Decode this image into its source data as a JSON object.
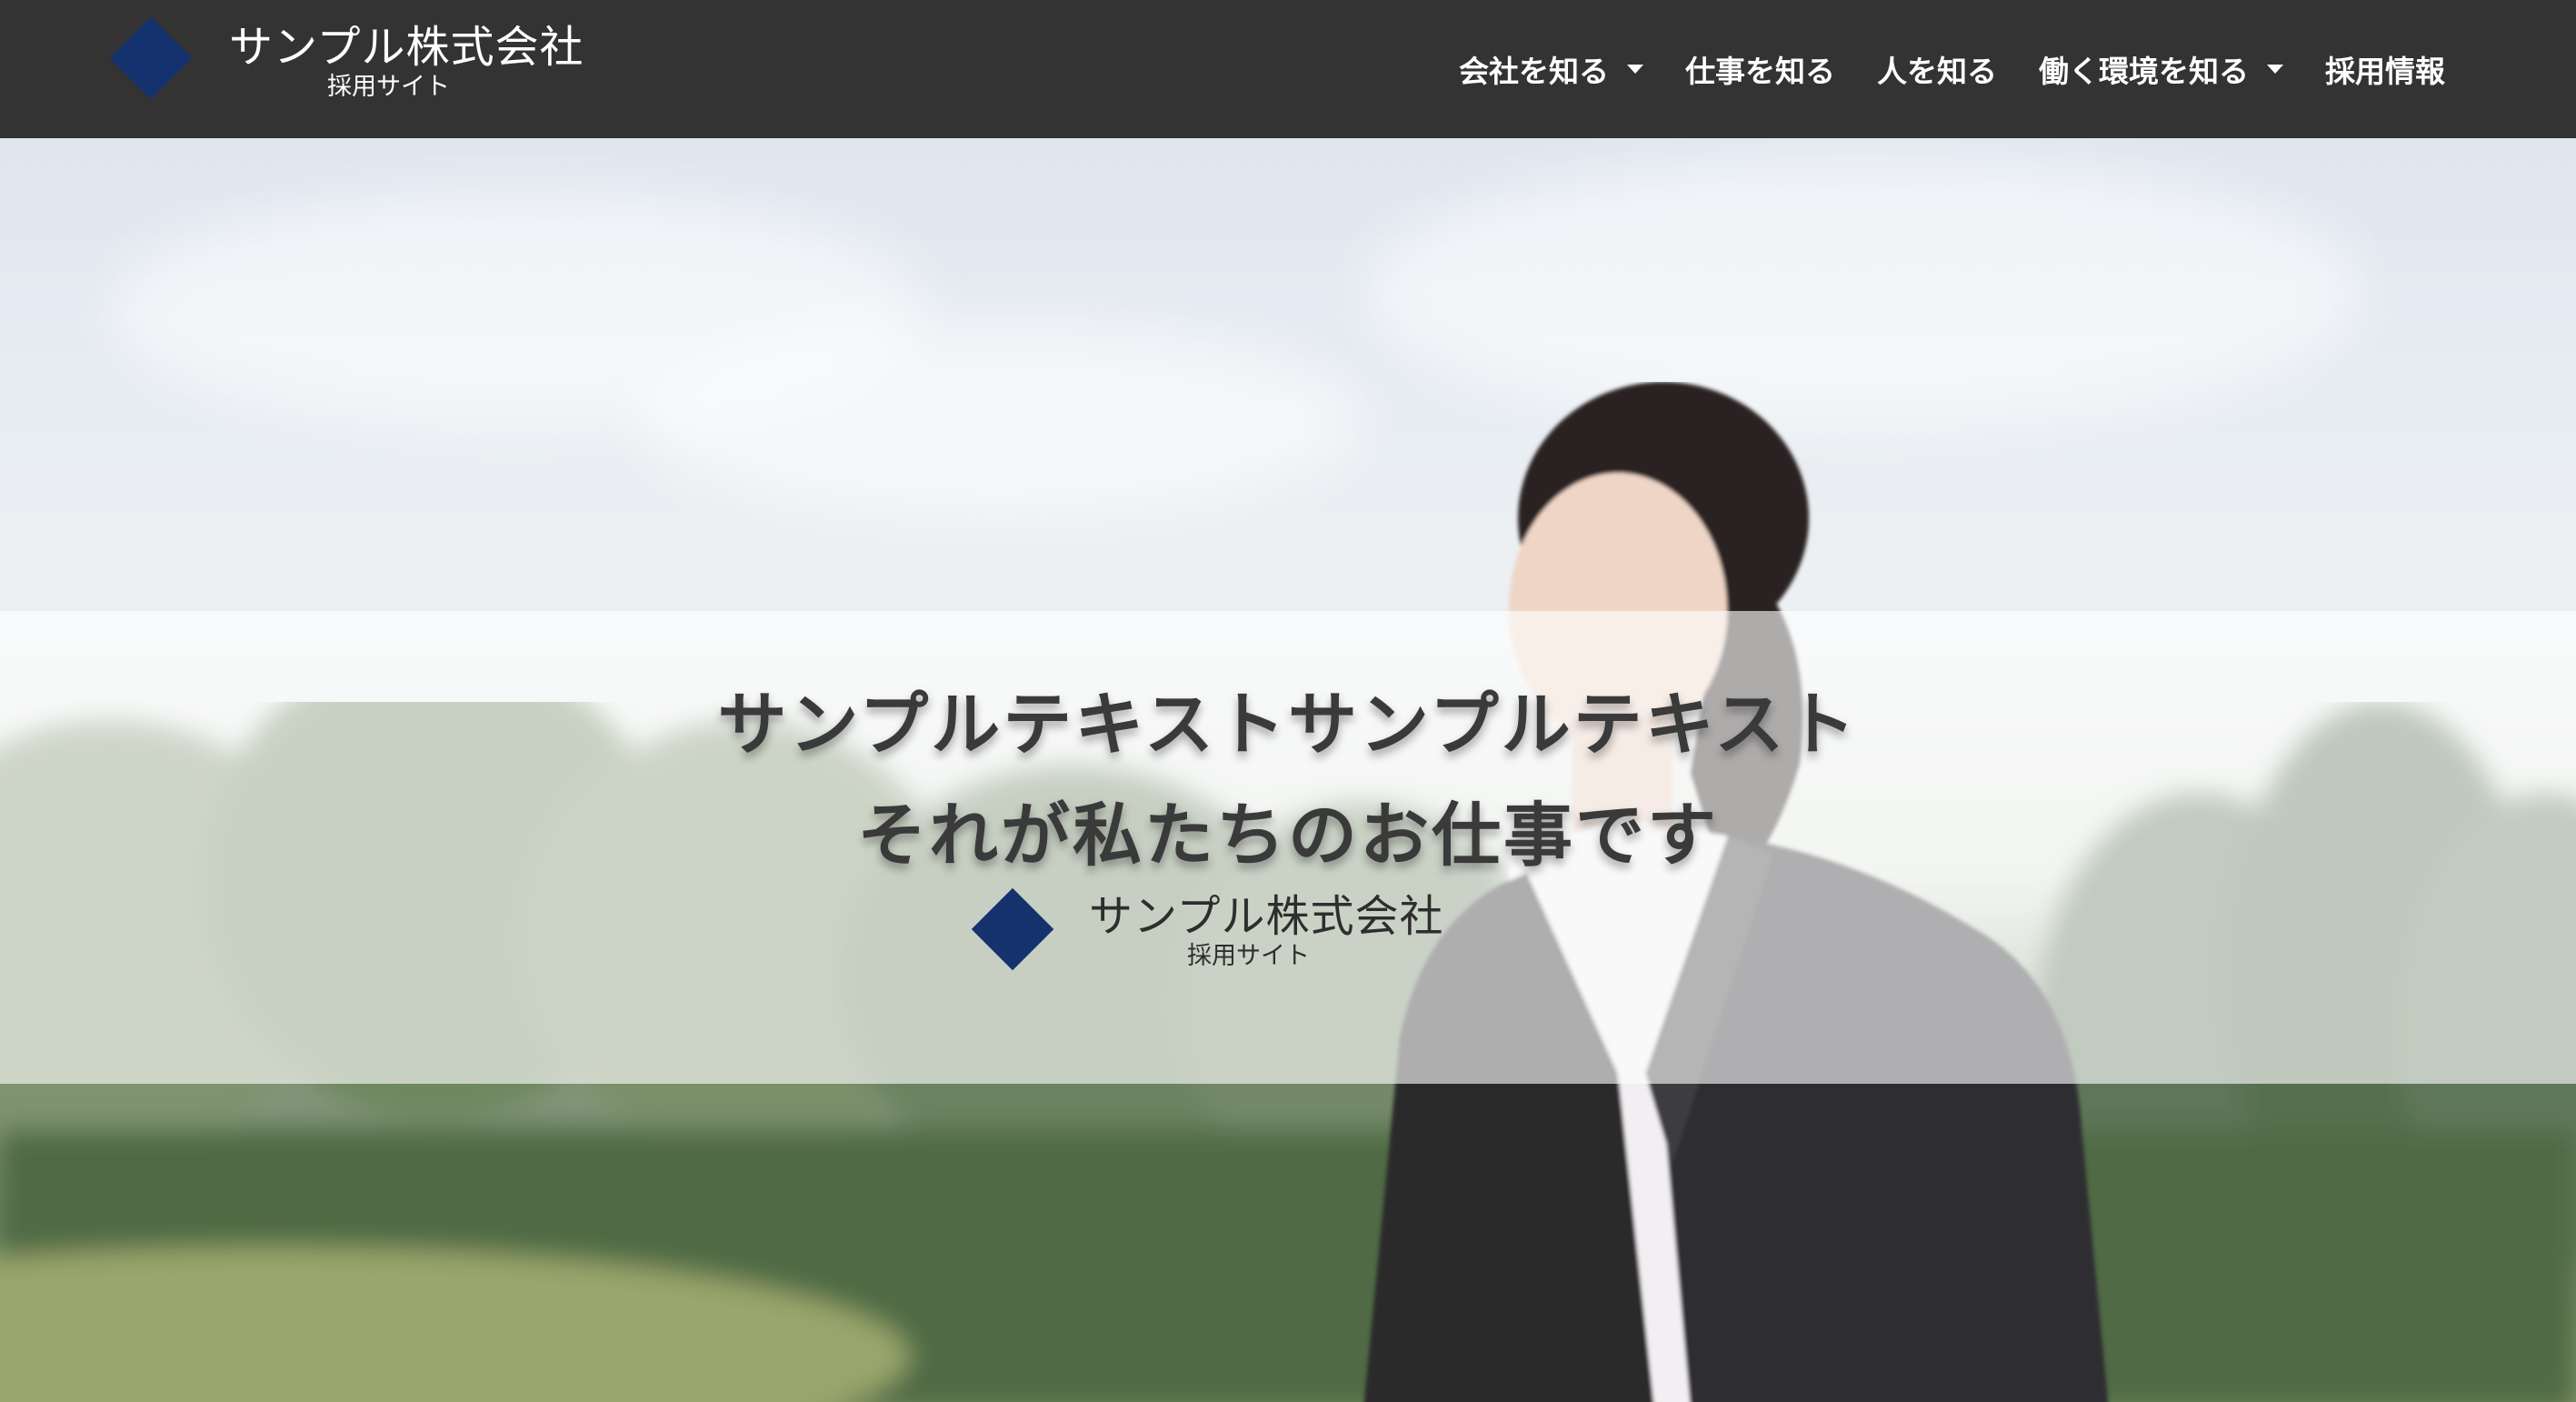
{
  "header": {
    "logo": {
      "name": "サンプル株式会社",
      "sub": "採用サイト"
    },
    "nav": [
      {
        "label": "会社を知る",
        "dropdown": true
      },
      {
        "label": "仕事を知る",
        "dropdown": false
      },
      {
        "label": "人を知る",
        "dropdown": false
      },
      {
        "label": "働く環境を知る",
        "dropdown": true
      },
      {
        "label": "採用情報",
        "dropdown": false
      }
    ]
  },
  "hero": {
    "title_line1": "サンプルテキストサンプルテキスト",
    "title_line2": "それが私たちのお仕事です",
    "logo": {
      "name": "サンプル株式会社",
      "sub": "採用サイト"
    }
  },
  "colors": {
    "header_bg": "#333333",
    "brand_navy": "#14336e",
    "header_text": "#ffffff"
  },
  "icons": [
    "diamond-logo-icon",
    "caret-down-icon"
  ]
}
